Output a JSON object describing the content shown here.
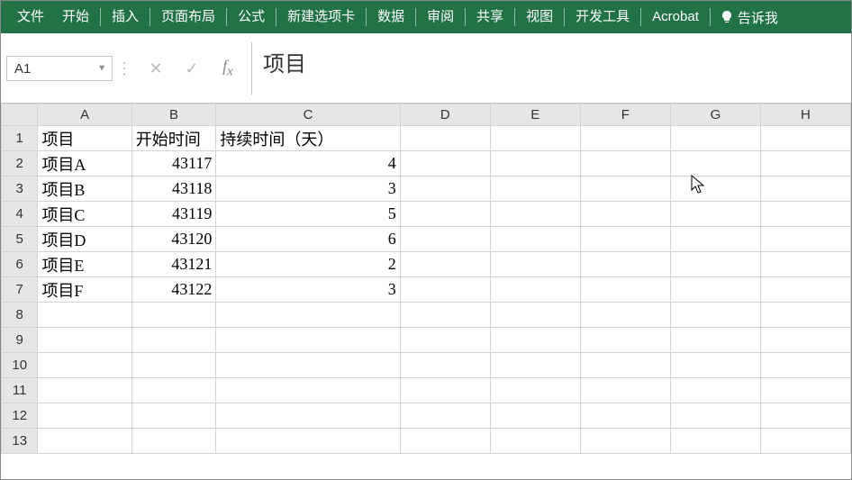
{
  "ribbon": {
    "file": "文件",
    "tabs": [
      "开始",
      "插入",
      "页面布局",
      "公式",
      "新建选项卡",
      "数据",
      "审阅",
      "共享",
      "视图",
      "开发工具",
      "Acrobat"
    ],
    "tellme": "告诉我"
  },
  "formula_bar": {
    "name_box": "A1",
    "content": "项目"
  },
  "columns": [
    "A",
    "B",
    "C",
    "D",
    "E",
    "F",
    "G",
    "H"
  ],
  "rows": [
    {
      "n": 1,
      "A": "项目",
      "B": "开始时间",
      "C": "持续时间（天）"
    },
    {
      "n": 2,
      "A": "项目A",
      "B": "43117",
      "C": "4"
    },
    {
      "n": 3,
      "A": "项目B",
      "B": "43118",
      "C": "3"
    },
    {
      "n": 4,
      "A": "项目C",
      "B": "43119",
      "C": "5"
    },
    {
      "n": 5,
      "A": "项目D",
      "B": "43120",
      "C": "6"
    },
    {
      "n": 6,
      "A": "项目E",
      "B": "43121",
      "C": "2"
    },
    {
      "n": 7,
      "A": "项目F",
      "B": "43122",
      "C": "3"
    },
    {
      "n": 8
    },
    {
      "n": 9
    },
    {
      "n": 10
    },
    {
      "n": 11
    },
    {
      "n": 12
    },
    {
      "n": 13
    }
  ],
  "col_widths": {
    "row_hdr": 38,
    "A": 98,
    "B": 88,
    "C": 192,
    "D": 94,
    "E": 94,
    "F": 94,
    "G": 94,
    "H": 94
  }
}
